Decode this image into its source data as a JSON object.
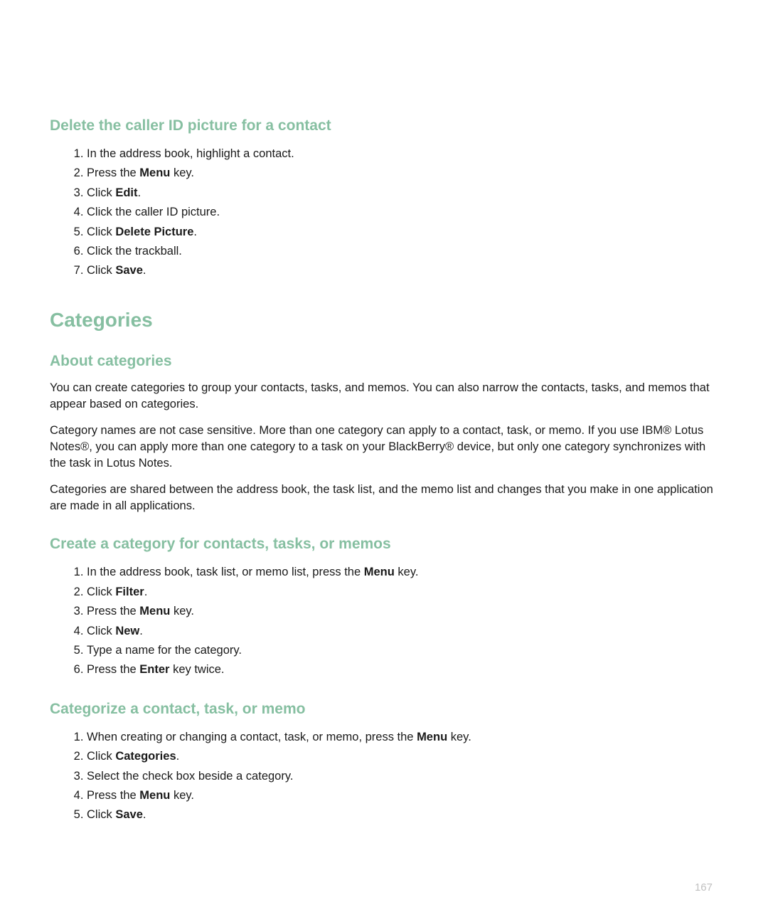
{
  "sections": [
    {
      "type": "h2",
      "title": "Delete the caller ID picture for a contact",
      "steps": [
        [
          {
            "t": "In the address book, highlight a contact."
          }
        ],
        [
          {
            "t": "Press the "
          },
          {
            "t": "Menu",
            "b": true
          },
          {
            "t": " key."
          }
        ],
        [
          {
            "t": "Click "
          },
          {
            "t": "Edit",
            "b": true
          },
          {
            "t": "."
          }
        ],
        [
          {
            "t": "Click the caller ID picture."
          }
        ],
        [
          {
            "t": "Click "
          },
          {
            "t": "Delete Picture",
            "b": true
          },
          {
            "t": "."
          }
        ],
        [
          {
            "t": "Click the trackball."
          }
        ],
        [
          {
            "t": "Click "
          },
          {
            "t": "Save",
            "b": true
          },
          {
            "t": "."
          }
        ]
      ]
    },
    {
      "type": "h1",
      "title": "Categories"
    },
    {
      "type": "h2",
      "title": "About categories",
      "paragraphs": [
        "You can create categories to group your contacts, tasks, and memos. You can also narrow the contacts, tasks, and memos that appear based on categories.",
        "Category names are not case sensitive. More than one category can apply to a contact, task, or memo. If you use IBM® Lotus Notes®, you can apply more than one category to a task on your BlackBerry® device, but only one category synchronizes with the task in Lotus Notes.",
        "Categories are shared between the address book, the task list, and the memo list and changes that you make in one application are made in all applications."
      ]
    },
    {
      "type": "h2",
      "title": "Create a category for contacts, tasks, or memos",
      "steps": [
        [
          {
            "t": "In the address book, task list, or memo list, press the "
          },
          {
            "t": "Menu",
            "b": true
          },
          {
            "t": " key."
          }
        ],
        [
          {
            "t": "Click "
          },
          {
            "t": "Filter",
            "b": true
          },
          {
            "t": "."
          }
        ],
        [
          {
            "t": "Press the "
          },
          {
            "t": "Menu",
            "b": true
          },
          {
            "t": " key."
          }
        ],
        [
          {
            "t": "Click "
          },
          {
            "t": "New",
            "b": true
          },
          {
            "t": "."
          }
        ],
        [
          {
            "t": "Type a name for the category."
          }
        ],
        [
          {
            "t": "Press the "
          },
          {
            "t": "Enter",
            "b": true
          },
          {
            "t": " key twice."
          }
        ]
      ]
    },
    {
      "type": "h2",
      "title": "Categorize a contact, task, or memo",
      "steps": [
        [
          {
            "t": "When creating or changing a contact, task, or memo, press the "
          },
          {
            "t": "Menu",
            "b": true
          },
          {
            "t": " key."
          }
        ],
        [
          {
            "t": "Click "
          },
          {
            "t": "Categories",
            "b": true
          },
          {
            "t": "."
          }
        ],
        [
          {
            "t": "Select the check box beside a category."
          }
        ],
        [
          {
            "t": "Press the "
          },
          {
            "t": "Menu",
            "b": true
          },
          {
            "t": " key."
          }
        ],
        [
          {
            "t": "Click "
          },
          {
            "t": "Save",
            "b": true
          },
          {
            "t": "."
          }
        ]
      ]
    }
  ],
  "pageNumber": "167"
}
